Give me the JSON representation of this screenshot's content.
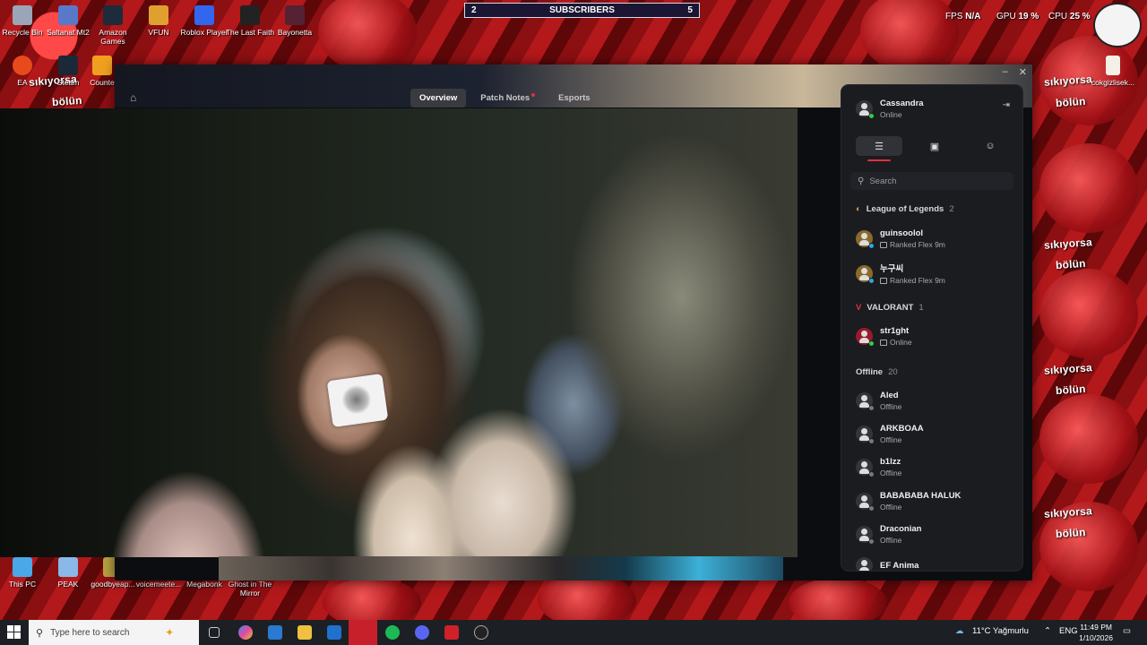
{
  "overlay": {
    "subscribers_left": "2",
    "subscribers_label": "SUBSCRIBERS",
    "subscribers_right": "5",
    "fps_label": "FPS",
    "fps_value": "N/A",
    "gpu_label": "GPU",
    "gpu_value": "19 %",
    "cpu_label": "CPU",
    "cpu_value": "25 %",
    "wallpaper_text_1": "sıkıyorsa",
    "wallpaper_text_2": "bölün"
  },
  "desktop_icons": [
    {
      "label": "Recycle Bin",
      "color": "#9aa6b8"
    },
    {
      "label": "Saltanat Mt2",
      "color": "#5a78c8"
    },
    {
      "label": "Amazon Games",
      "color": "#1d2b3a"
    },
    {
      "label": "VFUN",
      "color": "#e0a030"
    },
    {
      "label": "Roblox Player",
      "color": "#3366ee"
    },
    {
      "label": "The Last Faith",
      "color": "#222222"
    },
    {
      "label": "Bayonetta",
      "color": "#552233"
    },
    {
      "label": "EA",
      "color": "#e84a1c"
    },
    {
      "label": "Steam",
      "color": "#1b2838"
    },
    {
      "label": "Counte",
      "color": "#f0a020"
    },
    {
      "label": "This PC",
      "color": "#4aa8e8"
    },
    {
      "label": "PEAK",
      "color": "#8ab8e8"
    },
    {
      "label": "goodbyeap...",
      "color": "#b8a040"
    },
    {
      "label": "voicemeete...",
      "color": "#404040"
    },
    {
      "label": "Megabonk",
      "color": "#606060"
    },
    {
      "label": "Ghost in The Mirror",
      "color": "#e8e8e8"
    },
    {
      "label": "cokgizlisek...",
      "color": "#f4f0e8"
    }
  ],
  "client": {
    "tabs": [
      {
        "label": "Overview",
        "active": true
      },
      {
        "label": "Patch Notes",
        "active": false,
        "notification": true
      },
      {
        "label": "Esports",
        "active": false
      }
    ],
    "minimize": "–",
    "close": "✕"
  },
  "friends_panel": {
    "me": {
      "name": "Cassandra",
      "status": "Online"
    },
    "search_placeholder": "Search",
    "groups": [
      {
        "title": "League of Legends",
        "count": "2",
        "friends": [
          {
            "name": "guinsoolol",
            "status": "Ranked Flex 9m"
          },
          {
            "name": "누구씨",
            "status": "Ranked Flex 9m"
          }
        ]
      },
      {
        "title": "VALORANT",
        "count": "1",
        "friends": [
          {
            "name": "str1ght",
            "status": "Online"
          }
        ]
      },
      {
        "title": "Offline",
        "count": "20",
        "friends": [
          {
            "name": "Aled",
            "status": "Offline"
          },
          {
            "name": "ARKBOAA",
            "status": "Offline"
          },
          {
            "name": "b1lzz",
            "status": "Offline"
          },
          {
            "name": "BABABABA HALUK",
            "status": "Offline"
          },
          {
            "name": "Draconian",
            "status": "Offline"
          },
          {
            "name": "EF Anima",
            "status": ""
          }
        ]
      }
    ]
  },
  "taskbar": {
    "search_placeholder": "Type here to search",
    "weather": "11°C Yağmurlu",
    "language": "ENG",
    "time": "11:49 PM",
    "date": "1/10/2026"
  }
}
